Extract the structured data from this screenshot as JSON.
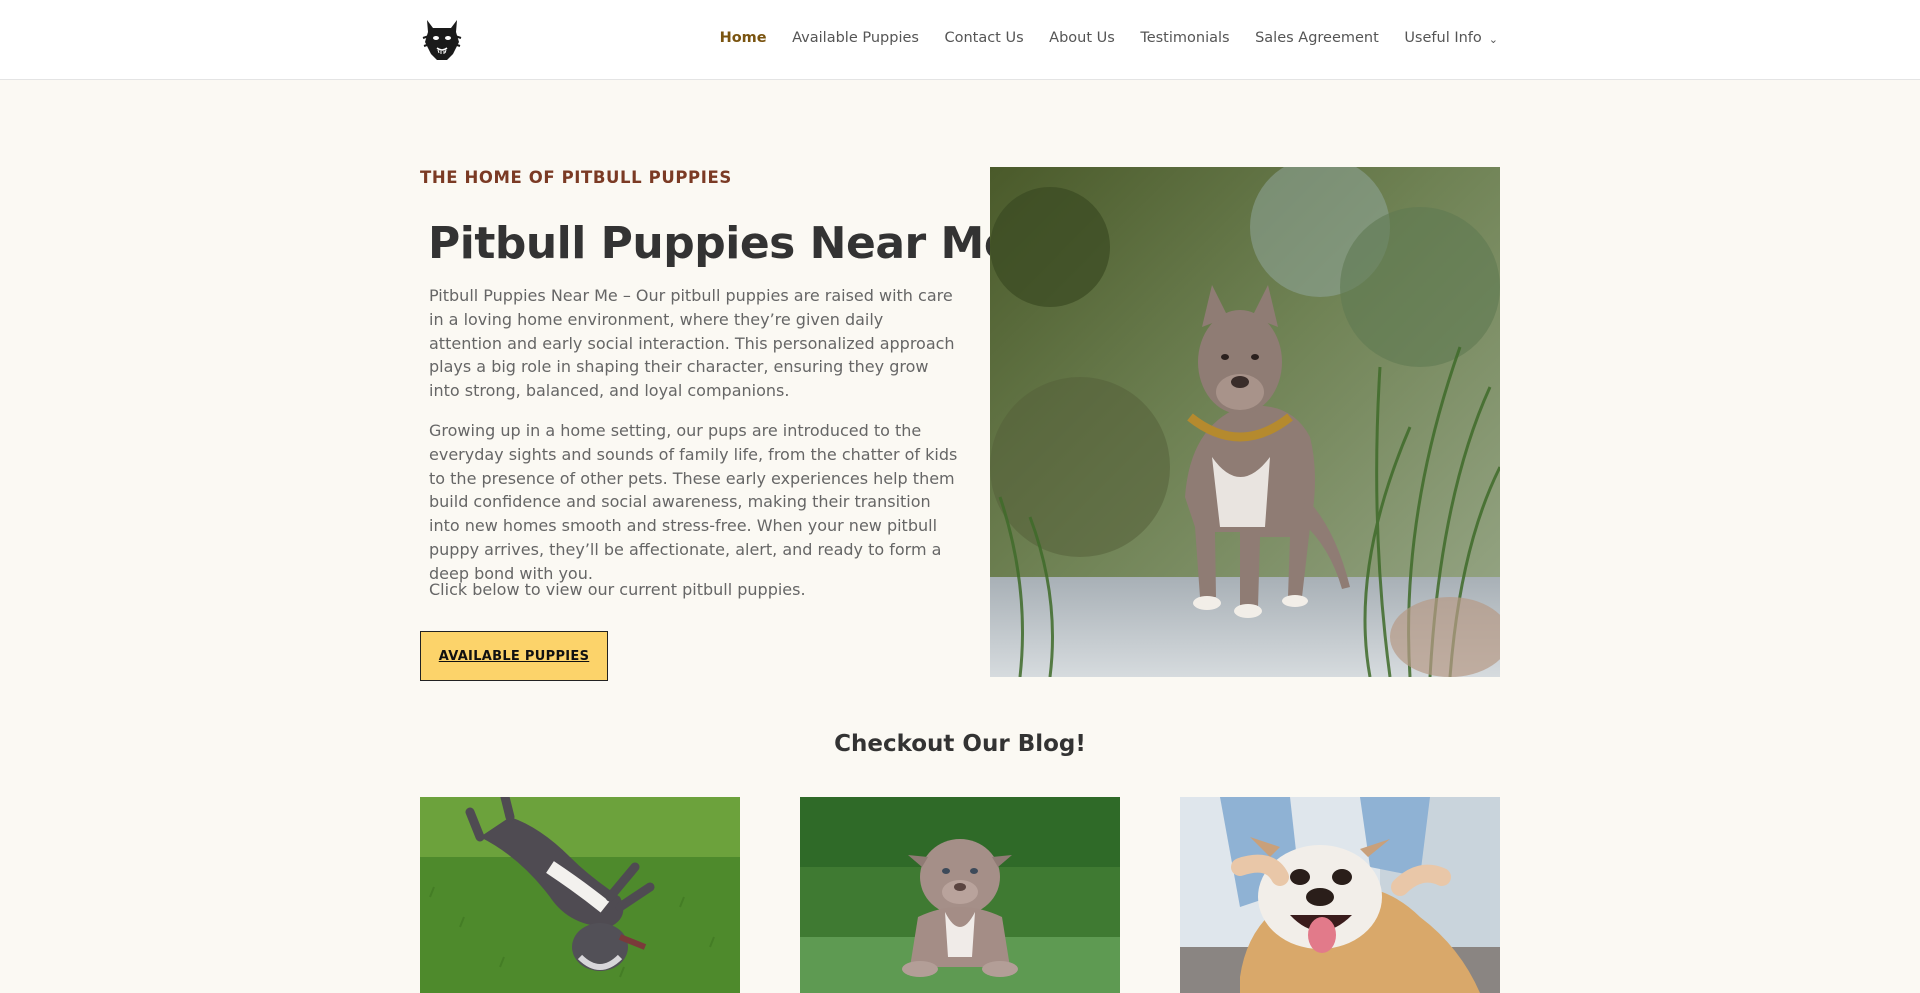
{
  "header": {
    "logo_icon": "pitbull-head-logo-icon",
    "nav": [
      {
        "label": "Home",
        "active": true
      },
      {
        "label": "Available Puppies"
      },
      {
        "label": "Contact Us"
      },
      {
        "label": "About Us"
      },
      {
        "label": "Testimonials"
      },
      {
        "label": "Sales Agreement"
      },
      {
        "label": "Useful Info",
        "dropdown_icon": "chevron-down-icon"
      }
    ]
  },
  "hero": {
    "eyebrow": "THE HOME OF PITBULL PUPPIES",
    "title": "Pitbull Puppies Near Me",
    "paragraphs": [
      "Pitbull Puppies Near Me – Our pitbull puppies are raised with care in a loving home environment, where they’re given daily attention and early social interaction. This personalized approach plays a big role in shaping their character, ensuring they grow into strong, balanced, and loyal companions.",
      "Growing up in a home setting, our pups are introduced to the everyday sights and sounds of family life, from the chatter of kids to the presence of other pets. These early experiences help them build confidence and social awareness, making their transition into new homes smooth and stress-free. When your new pitbull puppy arrives, they’ll be affectionate, alert, and ready to form a deep bond with you.",
      "Click below to view our current pitbull puppies."
    ],
    "cta_label": "AVAILABLE PUPPIES",
    "image": "pitbull-standing-photo"
  },
  "blog": {
    "heading": "Checkout Our Blog!",
    "cards": [
      {
        "image": "pitbull-rolling-on-grass-photo"
      },
      {
        "image": "pitbull-puppy-on-grass-photo"
      },
      {
        "image": "bulldog-at-vet-photo"
      }
    ]
  },
  "colors": {
    "background": "#fbf9f3",
    "accent_nav": "#7a5410",
    "eyebrow": "#7b3a24",
    "cta_bg": "#fcd36a"
  }
}
